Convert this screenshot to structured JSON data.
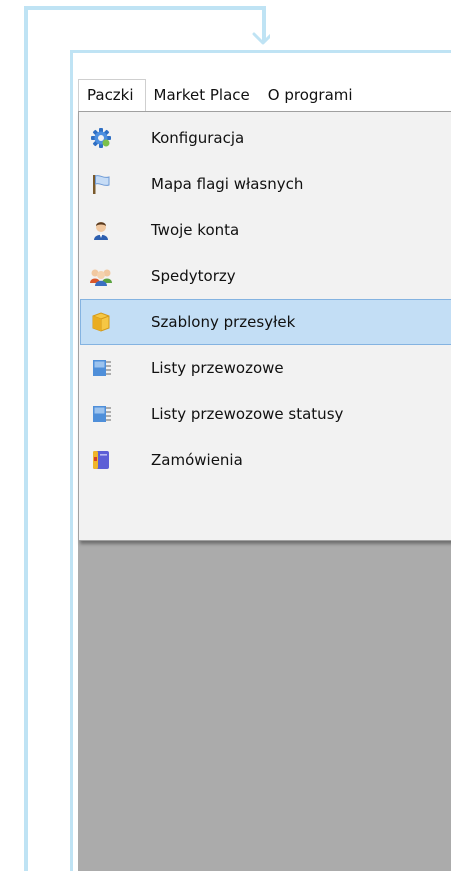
{
  "menubar": {
    "items": [
      {
        "label": "Paczki",
        "open": true
      },
      {
        "label": "Market Place",
        "open": false
      },
      {
        "label": "O programi",
        "open": false
      }
    ]
  },
  "dropdown": {
    "items": [
      {
        "label": "Konfiguracja",
        "icon": "gear-icon"
      },
      {
        "label": "Mapa flagi własnych",
        "icon": "flag-icon"
      },
      {
        "label": "Twoje konta",
        "icon": "user-icon"
      },
      {
        "label": "Spedytorzy",
        "icon": "users-group-icon"
      },
      {
        "label": "Szablony przesyłek",
        "icon": "package-icon",
        "highlighted": true
      },
      {
        "label": "Listy przewozowe",
        "icon": "document-list-icon"
      },
      {
        "label": "Listy przewozowe statusy",
        "icon": "document-list-icon"
      },
      {
        "label": "Zamówienia",
        "icon": "order-book-icon"
      }
    ]
  },
  "colors": {
    "guide": "#bfe3f4",
    "client_area": "#ababab",
    "menu_background": "#f2f2f2",
    "highlight": "#c3def5",
    "highlight_border": "#84b3e1"
  }
}
